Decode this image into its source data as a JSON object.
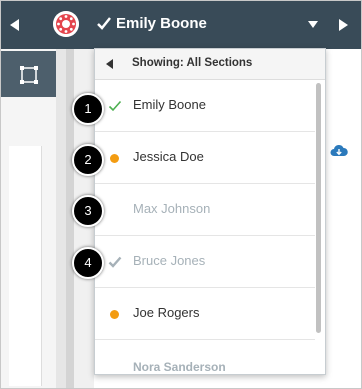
{
  "header": {
    "student_name": "Emily Boone",
    "accent_color": "#394b58"
  },
  "dropdown": {
    "title": "Showing: All Sections",
    "students": [
      {
        "name": "Emily Boone",
        "status": "graded",
        "status_icon": "check-icon",
        "status_color": "#4caf50",
        "name_color": "#333333"
      },
      {
        "name": "Jessica Doe",
        "status": "needs-grading",
        "status_icon": "dot-icon",
        "status_color": "#f39c12",
        "name_color": "#333333"
      },
      {
        "name": "Max Johnson",
        "status": "not-submitted",
        "status_icon": "",
        "status_color": "",
        "name_color": "#a6b1b8"
      },
      {
        "name": "Bruce Jones",
        "status": "graded-not-submitted",
        "status_icon": "check-icon",
        "status_color": "#a6b1b8",
        "name_color": "#a6b1b8"
      },
      {
        "name": "Joe Rogers",
        "status": "needs-grading",
        "status_icon": "dot-icon",
        "status_color": "#f39c12",
        "name_color": "#333333"
      },
      {
        "name": "Nora Sanderson",
        "status": "not-submitted",
        "status_icon": "",
        "status_color": "",
        "name_color": "#a6b1b8"
      }
    ]
  },
  "callouts": [
    "1",
    "2",
    "3",
    "4"
  ]
}
